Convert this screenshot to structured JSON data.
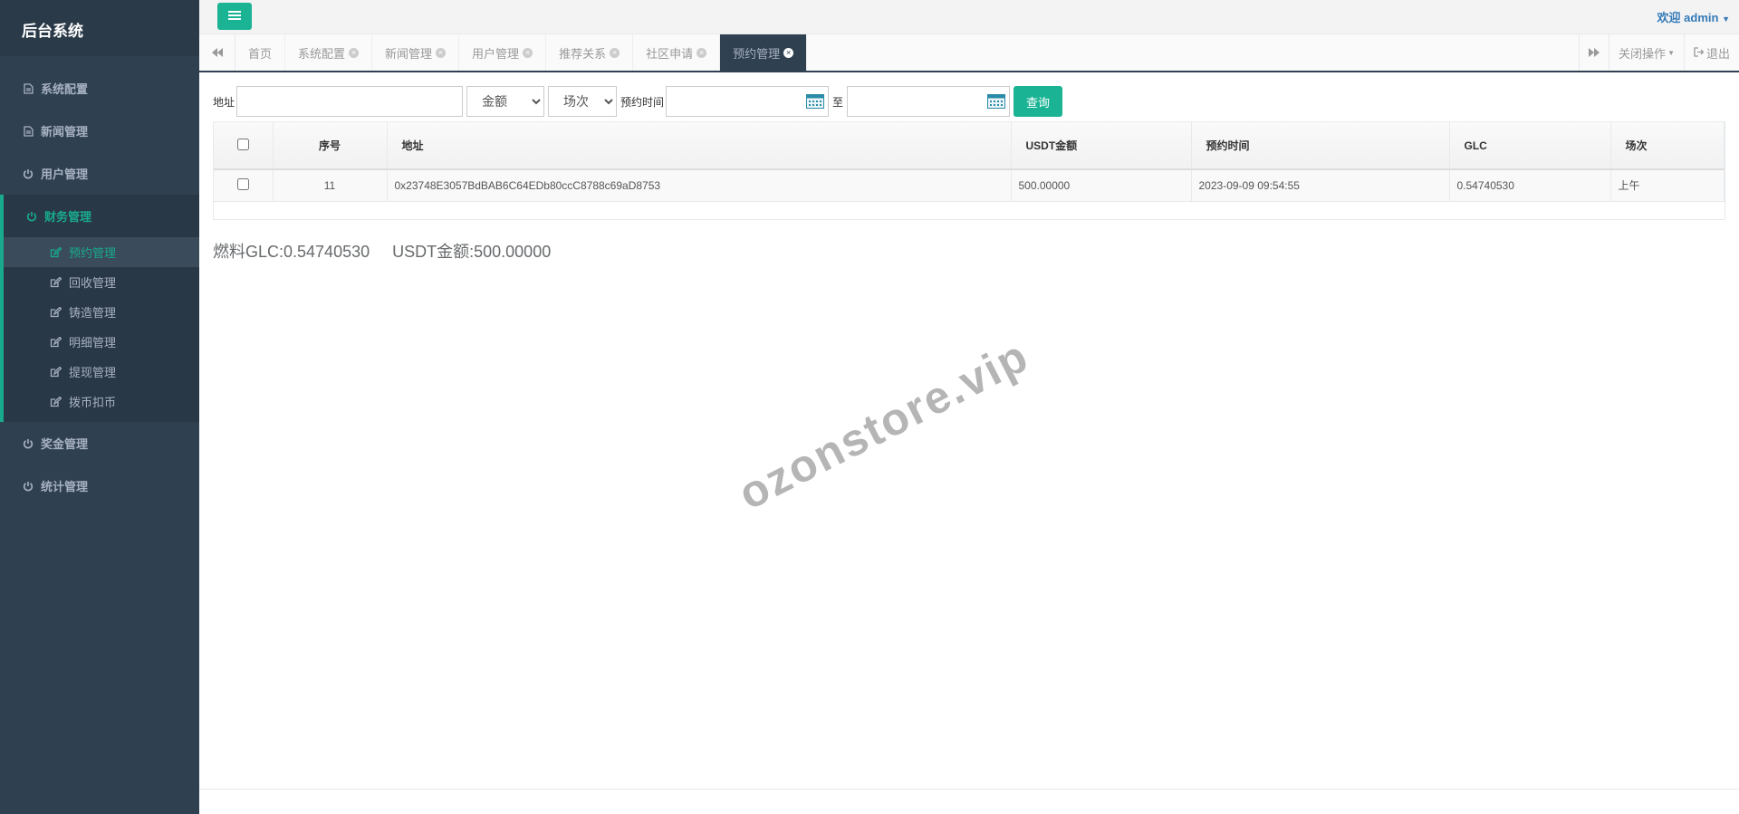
{
  "brand": "后台系统",
  "sidebar": {
    "items_top": [
      {
        "label": "系统配置",
        "icon": "file-icon"
      },
      {
        "label": "新闻管理",
        "icon": "file-icon"
      },
      {
        "label": "用户管理",
        "icon": "power-icon"
      }
    ],
    "active_group": {
      "label": "财务管理",
      "icon": "power-icon",
      "children": [
        {
          "label": "预约管理",
          "active": true
        },
        {
          "label": "回收管理"
        },
        {
          "label": "铸造管理"
        },
        {
          "label": "明细管理"
        },
        {
          "label": "提现管理"
        },
        {
          "label": "拨币扣币"
        }
      ]
    },
    "items_bottom": [
      {
        "label": "奖金管理",
        "icon": "power-icon"
      },
      {
        "label": "统计管理",
        "icon": "power-icon"
      }
    ]
  },
  "header": {
    "welcome": "欢迎 admin"
  },
  "tabs": [
    {
      "label": "首页",
      "closable": false
    },
    {
      "label": "系统配置",
      "closable": true
    },
    {
      "label": "新闻管理",
      "closable": true
    },
    {
      "label": "用户管理",
      "closable": true
    },
    {
      "label": "推荐关系",
      "closable": true
    },
    {
      "label": "社区申请",
      "closable": true
    },
    {
      "label": "预约管理",
      "closable": true,
      "active": true
    }
  ],
  "tab_actions": {
    "close_ops": "关闭操作",
    "logout": "退出"
  },
  "search": {
    "address_label": "地址",
    "address_value": "",
    "amount_select": "金额",
    "session_select": "场次",
    "time_label": "预约时间",
    "to_label": "至",
    "query_button": "查询"
  },
  "table": {
    "headers": [
      "序号",
      "地址",
      "USDT金额",
      "预约时间",
      "GLC",
      "场次"
    ],
    "rows": [
      {
        "id": "11",
        "address": "0x23748E3057BdBAB6C64EDb80ccC8788c69aD8753",
        "usdt": "500.00000",
        "time": "2023-09-09 09:54:55",
        "glc": "0.54740530",
        "session": "上午"
      }
    ]
  },
  "summary": {
    "fuel_glc": "燃料GLC:0.54740530",
    "usdt_amount": "USDT金额:500.00000"
  },
  "watermark": "ozonstore.vip",
  "colors": {
    "accent": "#1ab394",
    "sidebar": "#2f4050"
  }
}
